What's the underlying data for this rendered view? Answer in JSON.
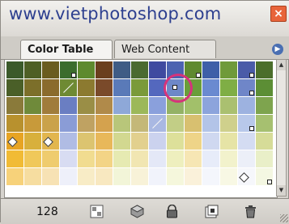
{
  "header": {
    "watermark": "www.vietphotoshop.com",
    "close_icon": "close-icon"
  },
  "tabs": [
    {
      "label": "Color Table",
      "active": true
    },
    {
      "label": "Web Content",
      "active": false
    }
  ],
  "colors": {
    "highlight_ring": "#d6337b",
    "watermark": "#2d3f8f"
  },
  "swatches": {
    "rows": [
      [
        "#3b5a2a",
        "#4e5f25",
        "#6a5c1f",
        "#3b6d2d",
        "#5e8a2e",
        "#6a3f1e",
        "#3f5c85",
        "#4a6a30",
        "#3f4aa0",
        "#4c63b1",
        "#5f8a30",
        "#3e5fa8",
        "#6f9a3a",
        "#4a5ba8",
        "#4b6e2b"
      ],
      [
        "#4a5f28",
        "#7c6f2a",
        "#8a6b2c",
        "#6e8a33",
        "#8c7a30",
        "#7a4a2a",
        "#5a7ab8",
        "#7a9a3a",
        "#5468be",
        "#6e88c8",
        "#6a9e3a",
        "#6a8ad0",
        "#7fae45",
        "#6f86c8",
        "#5c8e35"
      ],
      [
        "#8a7a3a",
        "#6f8a3a",
        "#a07c3b",
        "#6a7ec2",
        "#9a8e46",
        "#b08a4a",
        "#8ea8d8",
        "#9cb85a",
        "#8aa0dc",
        "#94b266",
        "#a2c06a",
        "#8ca4dc",
        "#aac070",
        "#9db2e0",
        "#7ea44e"
      ],
      [
        "#b8912e",
        "#c89a3a",
        "#caa24a",
        "#8a9cd6",
        "#bfa262",
        "#d4a24e",
        "#b8c67a",
        "#c4b878",
        "#a9b8e2",
        "#c2ce86",
        "#d8c070",
        "#b3c4e8",
        "#cfd08c",
        "#b8c8ea",
        "#a6c070"
      ],
      [
        "#e7a423",
        "#d8b03c",
        "#e2b64e",
        "#b0bce4",
        "#dcc470",
        "#e8b85a",
        "#d2d890",
        "#e2d08e",
        "#cbd2ee",
        "#dde09a",
        "#eed488",
        "#cfd8f0",
        "#e6e4a6",
        "#d4dcf2",
        "#d6dc98"
      ],
      [
        "#f1bb35",
        "#f0c85a",
        "#efcc6e",
        "#d8dcf2",
        "#f1dc90",
        "#f3d486",
        "#e6eab2",
        "#f1e6b2",
        "#e4e8f7",
        "#eeefbe",
        "#f6e6b4",
        "#e7ecf9",
        "#f2f2cc",
        "#eceff8",
        "#e9efc8"
      ],
      [
        "#f7d27a",
        "#f6dda0",
        "#f7e2b4",
        "#eef0fa",
        "#f8ecc6",
        "#f8e8c0",
        "#f2f5d8",
        "#f8f2d8",
        "#f1f3fb",
        "#f5f7dc",
        "#faf1da",
        "#f4f6fc",
        "#f8f8e4",
        "#f6f7fb",
        "#f4f7e2"
      ]
    ]
  },
  "status": {
    "count": "128"
  },
  "toolbar": [
    {
      "icon": "web-shift-icon"
    },
    {
      "icon": "web-snap-icon"
    },
    {
      "icon": "lock-icon"
    },
    {
      "icon": "new-color-icon"
    },
    {
      "icon": "trash-icon"
    }
  ]
}
